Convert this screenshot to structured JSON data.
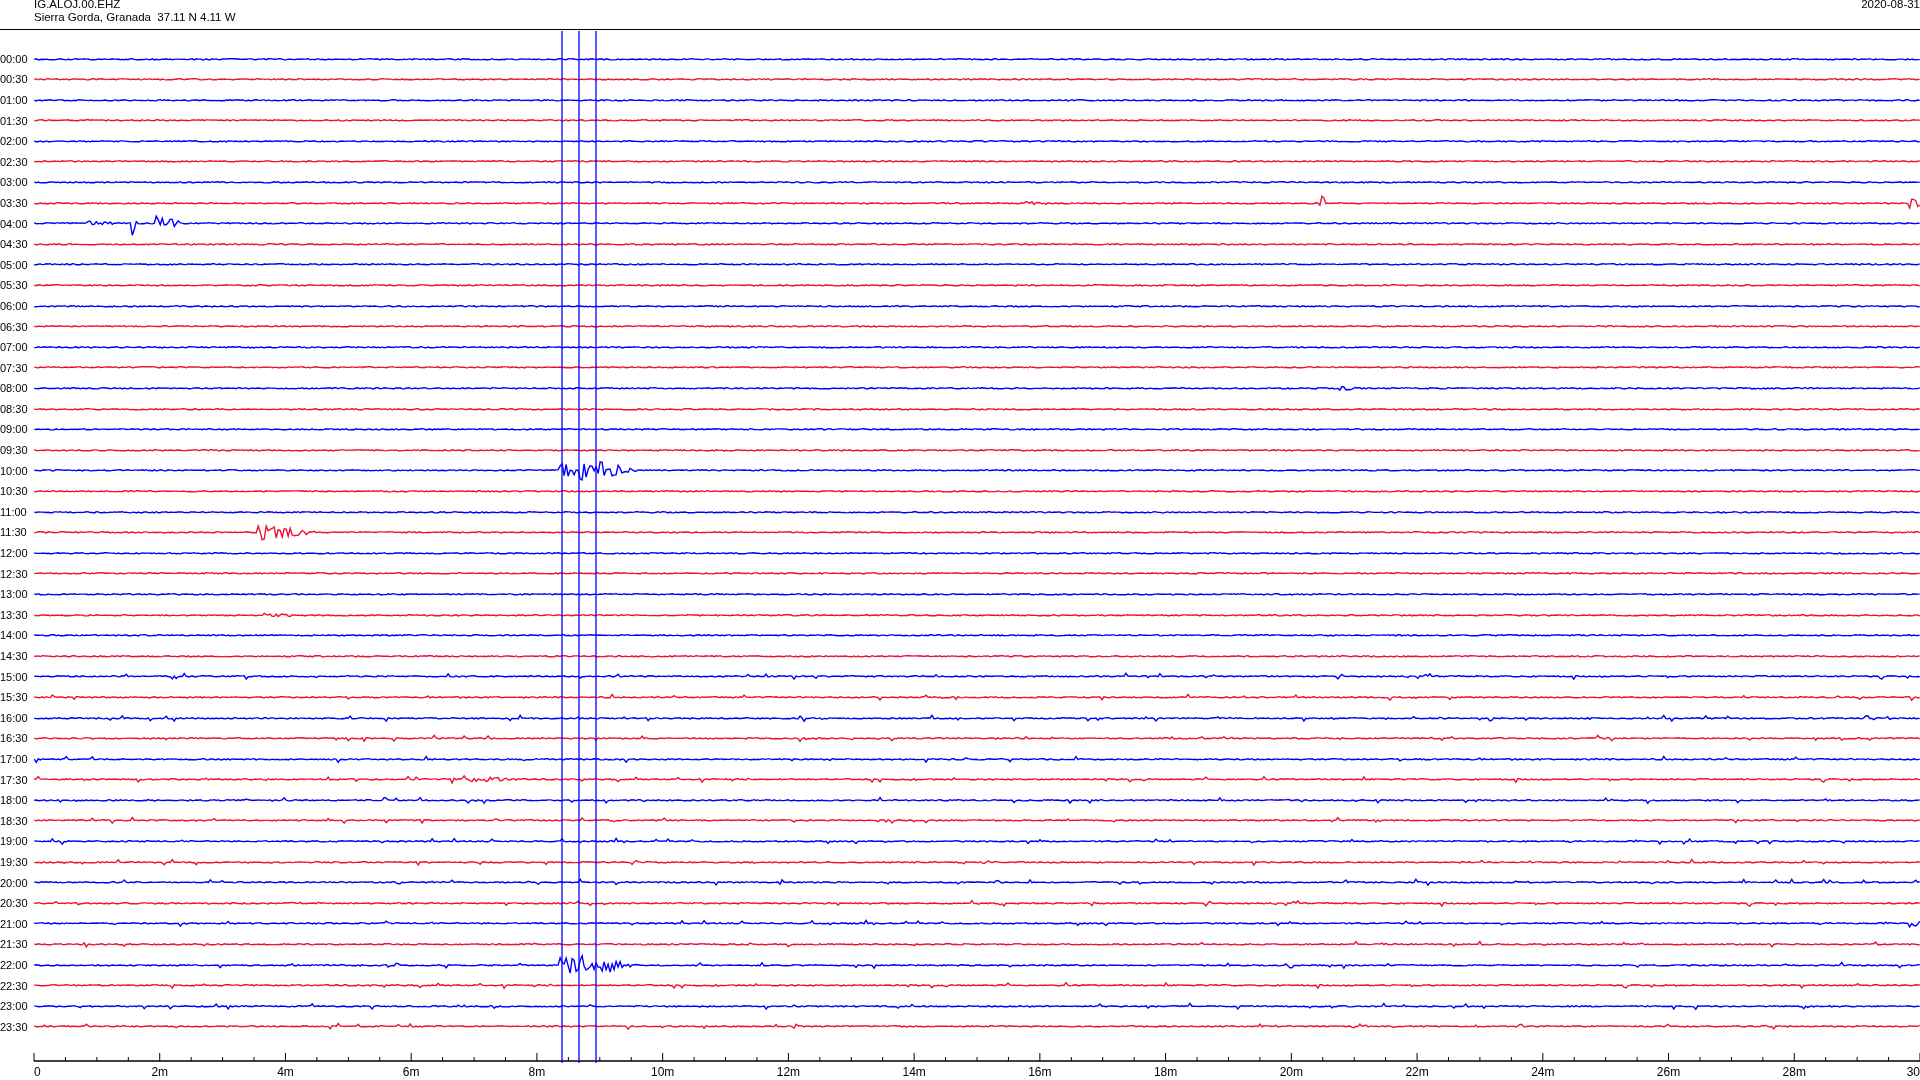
{
  "header": {
    "station": "IG.ALOJ.00.EHZ",
    "location": "Sierra Gorda, Granada  37.11 N 4.11 W",
    "date": "2020-08-31"
  },
  "rows": [
    {
      "label": "00:00",
      "color": "#0000ff"
    },
    {
      "label": "00:30",
      "color": "#ee1133"
    },
    {
      "label": "01:00",
      "color": "#0000ff"
    },
    {
      "label": "01:30",
      "color": "#ee1133"
    },
    {
      "label": "02:00",
      "color": "#0000ff"
    },
    {
      "label": "02:30",
      "color": "#ee1133"
    },
    {
      "label": "03:00",
      "color": "#0000ff"
    },
    {
      "label": "03:30",
      "color": "#ee1133"
    },
    {
      "label": "04:00",
      "color": "#0000ff"
    },
    {
      "label": "04:30",
      "color": "#ee1133"
    },
    {
      "label": "05:00",
      "color": "#0000ff"
    },
    {
      "label": "05:30",
      "color": "#ee1133"
    },
    {
      "label": "06:00",
      "color": "#0000ff"
    },
    {
      "label": "06:30",
      "color": "#ee1133"
    },
    {
      "label": "07:00",
      "color": "#0000ff"
    },
    {
      "label": "07:30",
      "color": "#ee1133"
    },
    {
      "label": "08:00",
      "color": "#0000ff"
    },
    {
      "label": "08:30",
      "color": "#ee1133"
    },
    {
      "label": "09:00",
      "color": "#0000ff"
    },
    {
      "label": "09:30",
      "color": "#ee1133"
    },
    {
      "label": "10:00",
      "color": "#0000ff"
    },
    {
      "label": "10:30",
      "color": "#ee1133"
    },
    {
      "label": "11:00",
      "color": "#0000ff"
    },
    {
      "label": "11:30",
      "color": "#ee1133"
    },
    {
      "label": "12:00",
      "color": "#0000ff"
    },
    {
      "label": "12:30",
      "color": "#ee1133"
    },
    {
      "label": "13:00",
      "color": "#0000ff"
    },
    {
      "label": "13:30",
      "color": "#ee1133"
    },
    {
      "label": "14:00",
      "color": "#0000ff"
    },
    {
      "label": "14:30",
      "color": "#ee1133"
    },
    {
      "label": "15:00",
      "color": "#0000ff"
    },
    {
      "label": "15:30",
      "color": "#ee1133"
    },
    {
      "label": "16:00",
      "color": "#0000ff"
    },
    {
      "label": "16:30",
      "color": "#ee1133"
    },
    {
      "label": "17:00",
      "color": "#0000ff"
    },
    {
      "label": "17:30",
      "color": "#ee1133"
    },
    {
      "label": "18:00",
      "color": "#0000ff"
    },
    {
      "label": "18:30",
      "color": "#ee1133"
    },
    {
      "label": "19:00",
      "color": "#0000ff"
    },
    {
      "label": "19:30",
      "color": "#ee1133"
    },
    {
      "label": "20:00",
      "color": "#0000ff"
    },
    {
      "label": "20:30",
      "color": "#ee1133"
    },
    {
      "label": "21:00",
      "color": "#0000ff"
    },
    {
      "label": "21:30",
      "color": "#ee1133"
    },
    {
      "label": "22:00",
      "color": "#0000ff"
    },
    {
      "label": "22:30",
      "color": "#ee1133"
    },
    {
      "label": "23:00",
      "color": "#0000ff"
    },
    {
      "label": "23:30",
      "color": "#ee1133"
    }
  ],
  "x_axis": {
    "ticks": [
      "0",
      "2m",
      "4m",
      "6m",
      "8m",
      "10m",
      "12m",
      "14m",
      "16m",
      "18m",
      "20m",
      "22m",
      "24m",
      "26m",
      "28m",
      "30"
    ]
  }
}
